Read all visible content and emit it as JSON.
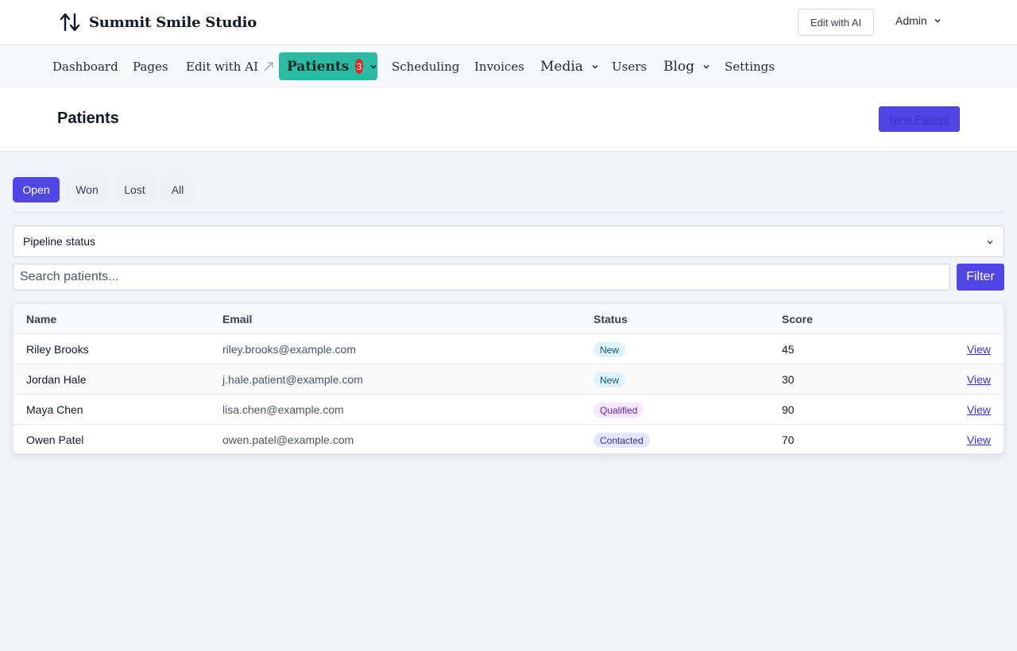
{
  "app": {
    "brand_name": "Summit Smile Studio",
    "brand_icon": "sort-arrows-icon",
    "edit_ai_label": "Edit with AI",
    "admin_label": "Admin"
  },
  "nav": {
    "items": [
      {
        "label": "Dashboard"
      },
      {
        "label": "Pages"
      },
      {
        "label": "Edit with AI",
        "icon": "external-arrow-icon"
      },
      {
        "label": "Patients",
        "badge": "3",
        "active": true
      },
      {
        "label": "Scheduling"
      },
      {
        "label": "Invoices"
      },
      {
        "label": "Media",
        "dropdown": true
      },
      {
        "label": "Users"
      },
      {
        "label": "Blog",
        "dropdown": true
      },
      {
        "label": "Settings"
      }
    ],
    "active_color": "#2bbba3"
  },
  "page": {
    "title": "Patients",
    "new_button_label": "New Patient"
  },
  "tabs": [
    {
      "label": "Open",
      "active": true
    },
    {
      "label": "Won"
    },
    {
      "label": "Lost"
    },
    {
      "label": "All"
    }
  ],
  "filters": {
    "pipeline_select_value": "Pipeline status",
    "search_placeholder": "Search patients...",
    "filter_button_label": "Filter"
  },
  "table": {
    "columns": [
      "Name",
      "Email",
      "Status",
      "Score"
    ],
    "rows": [
      {
        "name": "Riley Brooks",
        "email": "riley.brooks@example.com",
        "status": "New",
        "score": "45",
        "action": "View"
      },
      {
        "name": "Jordan Hale",
        "email": "j.hale.patient@example.com",
        "status": "New",
        "score": "30",
        "action": "View"
      },
      {
        "name": "Maya Chen",
        "email": "lisa.chen@example.com",
        "status": "Qualified",
        "score": "90",
        "action": "View"
      },
      {
        "name": "Owen Patel",
        "email": "owen.patel@example.com",
        "status": "Contacted",
        "score": "70",
        "action": "View"
      }
    ]
  },
  "colors": {
    "primary": "#4f46e5",
    "badge_new": "#e0f2fe",
    "badge_qualified": "#f3e8ff",
    "badge_contacted": "#e0e7ff",
    "nav_badge": "#dc2626"
  }
}
